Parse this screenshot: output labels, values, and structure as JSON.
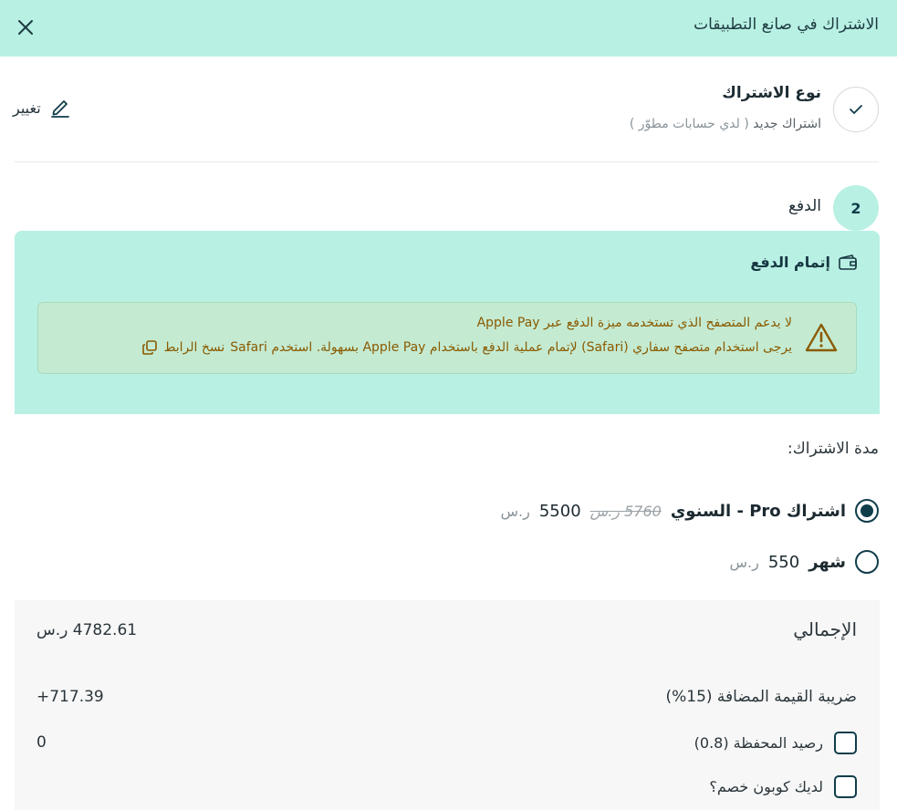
{
  "header": {
    "title": "الاشتراك في صانع التطبيقات",
    "close_icon": "close-icon"
  },
  "step1": {
    "title": "نوع الاشتراك",
    "subtitle_main": "اشتراك جديد",
    "subtitle_note": "( لدي حسابات مطوّر )",
    "status_icon": "check-icon",
    "change_label": "تغيير",
    "change_icon": "pencil-icon"
  },
  "step2": {
    "number": "2",
    "title": "الدفع"
  },
  "payment": {
    "title": "إتمام الدفع",
    "icon": "wallet-icon",
    "warning": {
      "icon": "warning-triangle-icon",
      "line1": "لا يدعم المتصفح الذي تستخدمه ميزة الدفع عبر Apple Pay",
      "line2": "يرجى استخدام متصفح سفاري (Safari) لإتمام عملية الدفع باستخدام Apple Pay بسهولة. استخدم Safari",
      "copy_label": "نسخ الرابط",
      "copy_icon": "copy-icon"
    }
  },
  "duration": {
    "label": "مدة الاشتراك:",
    "options": [
      {
        "name": "اشتراك Pro - السنوي",
        "old_price": "5760 ر.س",
        "price": "5500",
        "currency": "ر.س",
        "selected": true
      },
      {
        "name": "شهر",
        "price": "550",
        "currency": "ر.س",
        "selected": false
      }
    ]
  },
  "summary": {
    "total_label": "الإجمالي",
    "total_value": "4782.61 ر.س",
    "vat_label": "ضريبة القيمة المضافة (15%)",
    "vat_value": "+717.39",
    "wallet_label": "رصيد المحفظة (0.8)",
    "wallet_value": "0",
    "coupon_label": "لديك كوبون خصم؟"
  },
  "colors": {
    "accent_mint": "#b8f0e4",
    "primary_dark": "#0f3d4a",
    "warning_text": "#8a5a00",
    "warning_bg": "#c4ebd2"
  }
}
